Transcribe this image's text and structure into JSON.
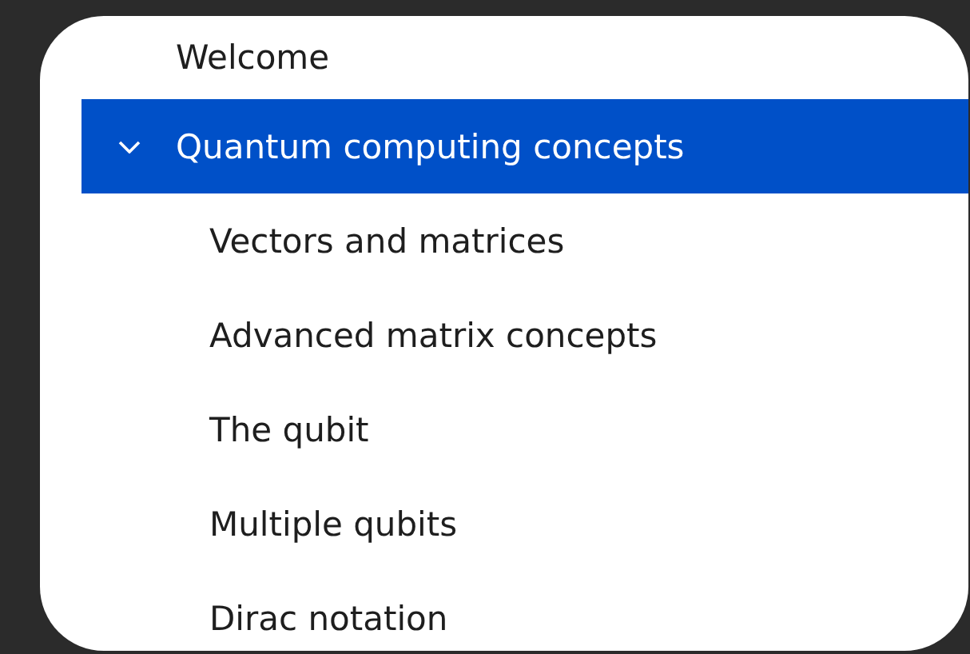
{
  "tree": [
    {
      "label": "Welcome",
      "selected": false
    },
    {
      "label": "Quantum computing concepts",
      "selected": true,
      "expanded": true,
      "children": [
        {
          "label": "Vectors and matrices",
          "selected": false
        },
        {
          "label": "Advanced matrix concepts",
          "selected": false
        },
        {
          "label": "The qubit",
          "selected": false
        },
        {
          "label": "Multiple qubits",
          "selected": false
        },
        {
          "label": "Dirac notation",
          "selected": false
        }
      ]
    }
  ]
}
